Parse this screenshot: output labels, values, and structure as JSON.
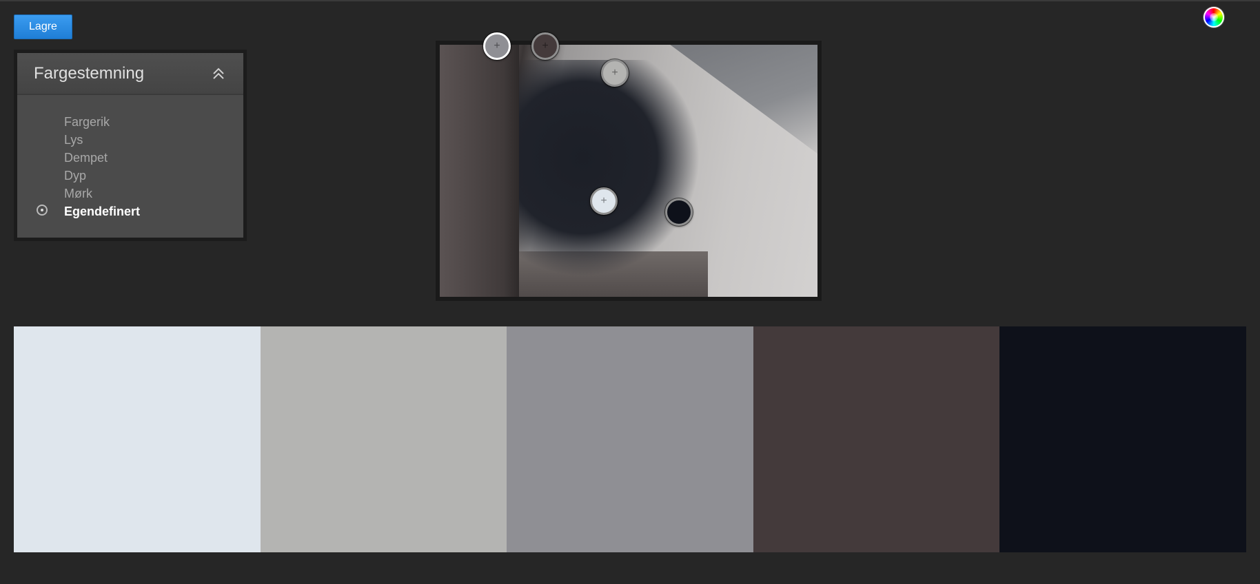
{
  "toolbar": {
    "save_label": "Lagre"
  },
  "panel": {
    "title": "Fargestemning",
    "moods": [
      {
        "label": "Fargerik",
        "selected": false
      },
      {
        "label": "Lys",
        "selected": false
      },
      {
        "label": "Dempet",
        "selected": false
      },
      {
        "label": "Dyp",
        "selected": false
      },
      {
        "label": "Mørk",
        "selected": false
      },
      {
        "label": "Egendefinert",
        "selected": true
      }
    ]
  },
  "pickers": [
    {
      "color": "#8f8f94",
      "plus": "+"
    },
    {
      "color": "#443a3b",
      "plus": "+"
    },
    {
      "color": "#b4b4b2",
      "plus": "+"
    },
    {
      "color": "#dfe6ed",
      "plus": "+"
    },
    {
      "color": "#0e111a",
      "plus": ""
    }
  ],
  "swatches": [
    "#dfe6ed",
    "#b4b4b2",
    "#8f8f94",
    "#443a3b",
    "#0e111a"
  ],
  "icons": {
    "collapse": "double-chevron-up-icon",
    "color_wheel": "color-wheel-icon",
    "selected_marker": "radio-selected-icon"
  }
}
